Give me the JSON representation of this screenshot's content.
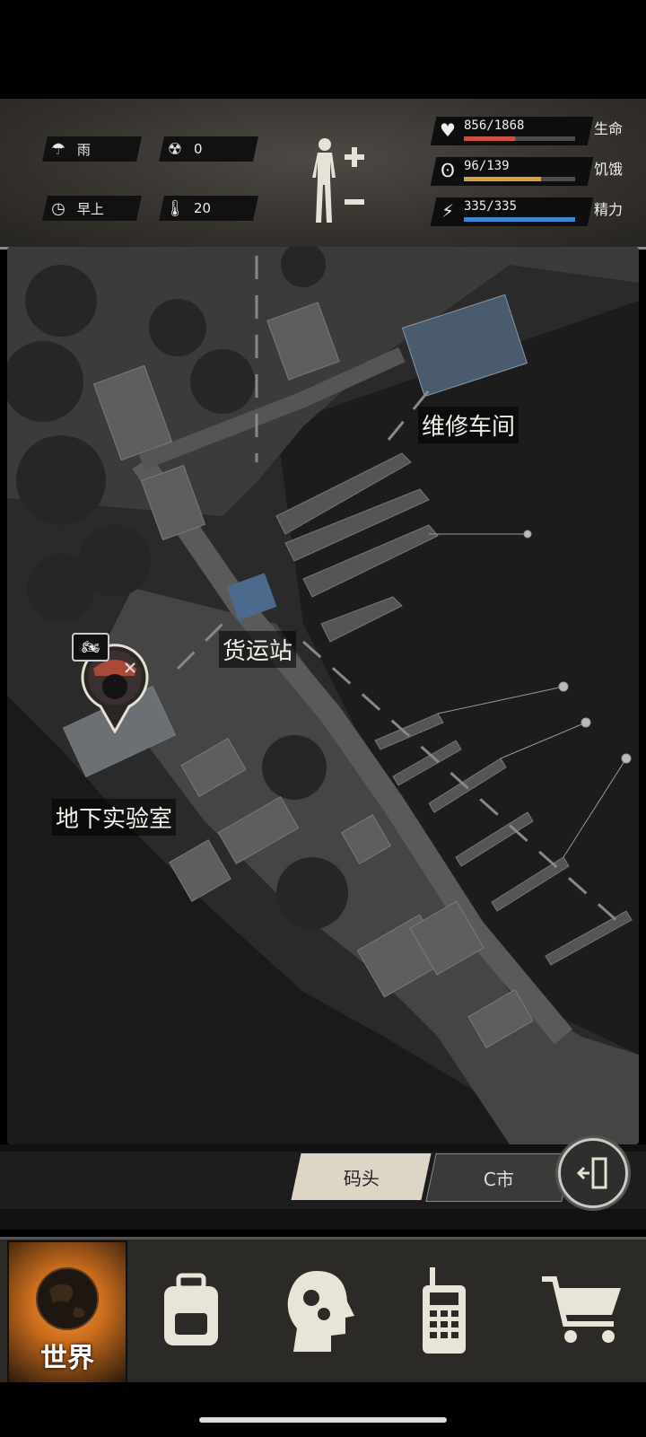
{
  "weather": {
    "icon": "rain-icon",
    "label": "雨"
  },
  "radiation": {
    "icon": "radiation-icon",
    "value": "0"
  },
  "time": {
    "icon": "clock-icon",
    "label": "早上"
  },
  "temperature": {
    "icon": "thermometer-icon",
    "value": "20"
  },
  "stats": {
    "life": {
      "value": "856/1868",
      "label": "生命",
      "fraction": 0.458,
      "color": "#d05040"
    },
    "hunger": {
      "value": "96/139",
      "label": "饥饿",
      "fraction": 0.69,
      "color": "#d8a040"
    },
    "energy": {
      "value": "335/335",
      "label": "精力",
      "fraction": 1.0,
      "color": "#3a86d8"
    }
  },
  "map": {
    "locations": {
      "repair_shop": "维修车间",
      "freight_station": "货运站",
      "underground_lab": "地下实验室"
    }
  },
  "location_tabs": {
    "dock": "码头",
    "city": "C市"
  },
  "nav": {
    "world": "世界"
  }
}
